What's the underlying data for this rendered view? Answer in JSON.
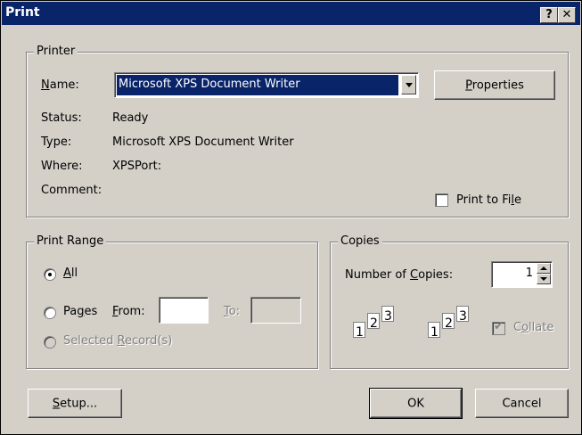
{
  "window": {
    "title": "Print",
    "help_label": "?",
    "close_label": "✕"
  },
  "printer": {
    "legend": "Printer",
    "name_label": "Name:",
    "selected_printer": "Microsoft XPS Document Writer",
    "properties_label": "Properties",
    "status_label": "Status:",
    "status_value": "Ready",
    "type_label": "Type:",
    "type_value": "Microsoft XPS Document Writer",
    "where_label": "Where:",
    "where_value": "XPSPort:",
    "comment_label": "Comment:",
    "comment_value": "",
    "print_to_file_label": "Print to File",
    "print_to_file_checked": false
  },
  "print_range": {
    "legend": "Print Range",
    "all_label": "All",
    "pages_label": "Pages",
    "from_label": "From:",
    "from_value": "",
    "to_label": "To:",
    "to_value": "",
    "selected_records_label": "Selected Record(s)",
    "selected": "All"
  },
  "copies": {
    "legend": "Copies",
    "number_label": "Number of Copies:",
    "number_value": "1",
    "collate_label": "Collate",
    "collate_checked": true,
    "collate_enabled": false,
    "page_numbers": [
      "1",
      "2",
      "3"
    ]
  },
  "buttons": {
    "setup": "Setup...",
    "ok": "OK",
    "cancel": "Cancel"
  }
}
